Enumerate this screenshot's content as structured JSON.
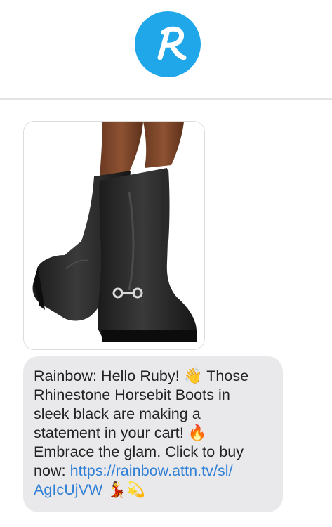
{
  "header": {
    "avatar_icon": "rainbow-r-logo-icon",
    "avatar_letter": "R",
    "avatar_color": "#1fa7ea"
  },
  "message": {
    "image_icon": "black-knee-high-boots-product-photo",
    "lines": [
      "Rainbow: Hello Ruby! 👋 Those",
      "Rhinestone Horsebit Boots in",
      "sleek black are making a",
      "statement in your cart! 🔥",
      "Embrace the glam. Click to buy"
    ],
    "line6_prefix": "now: ",
    "link_part1": "https://rainbow.attn.tv/sl/",
    "link_part2": "AgIcUjVW",
    "trailing_emoji": " 💃💫",
    "link_color": "#2f7fd6",
    "bubble_color": "#e9e9eb"
  }
}
